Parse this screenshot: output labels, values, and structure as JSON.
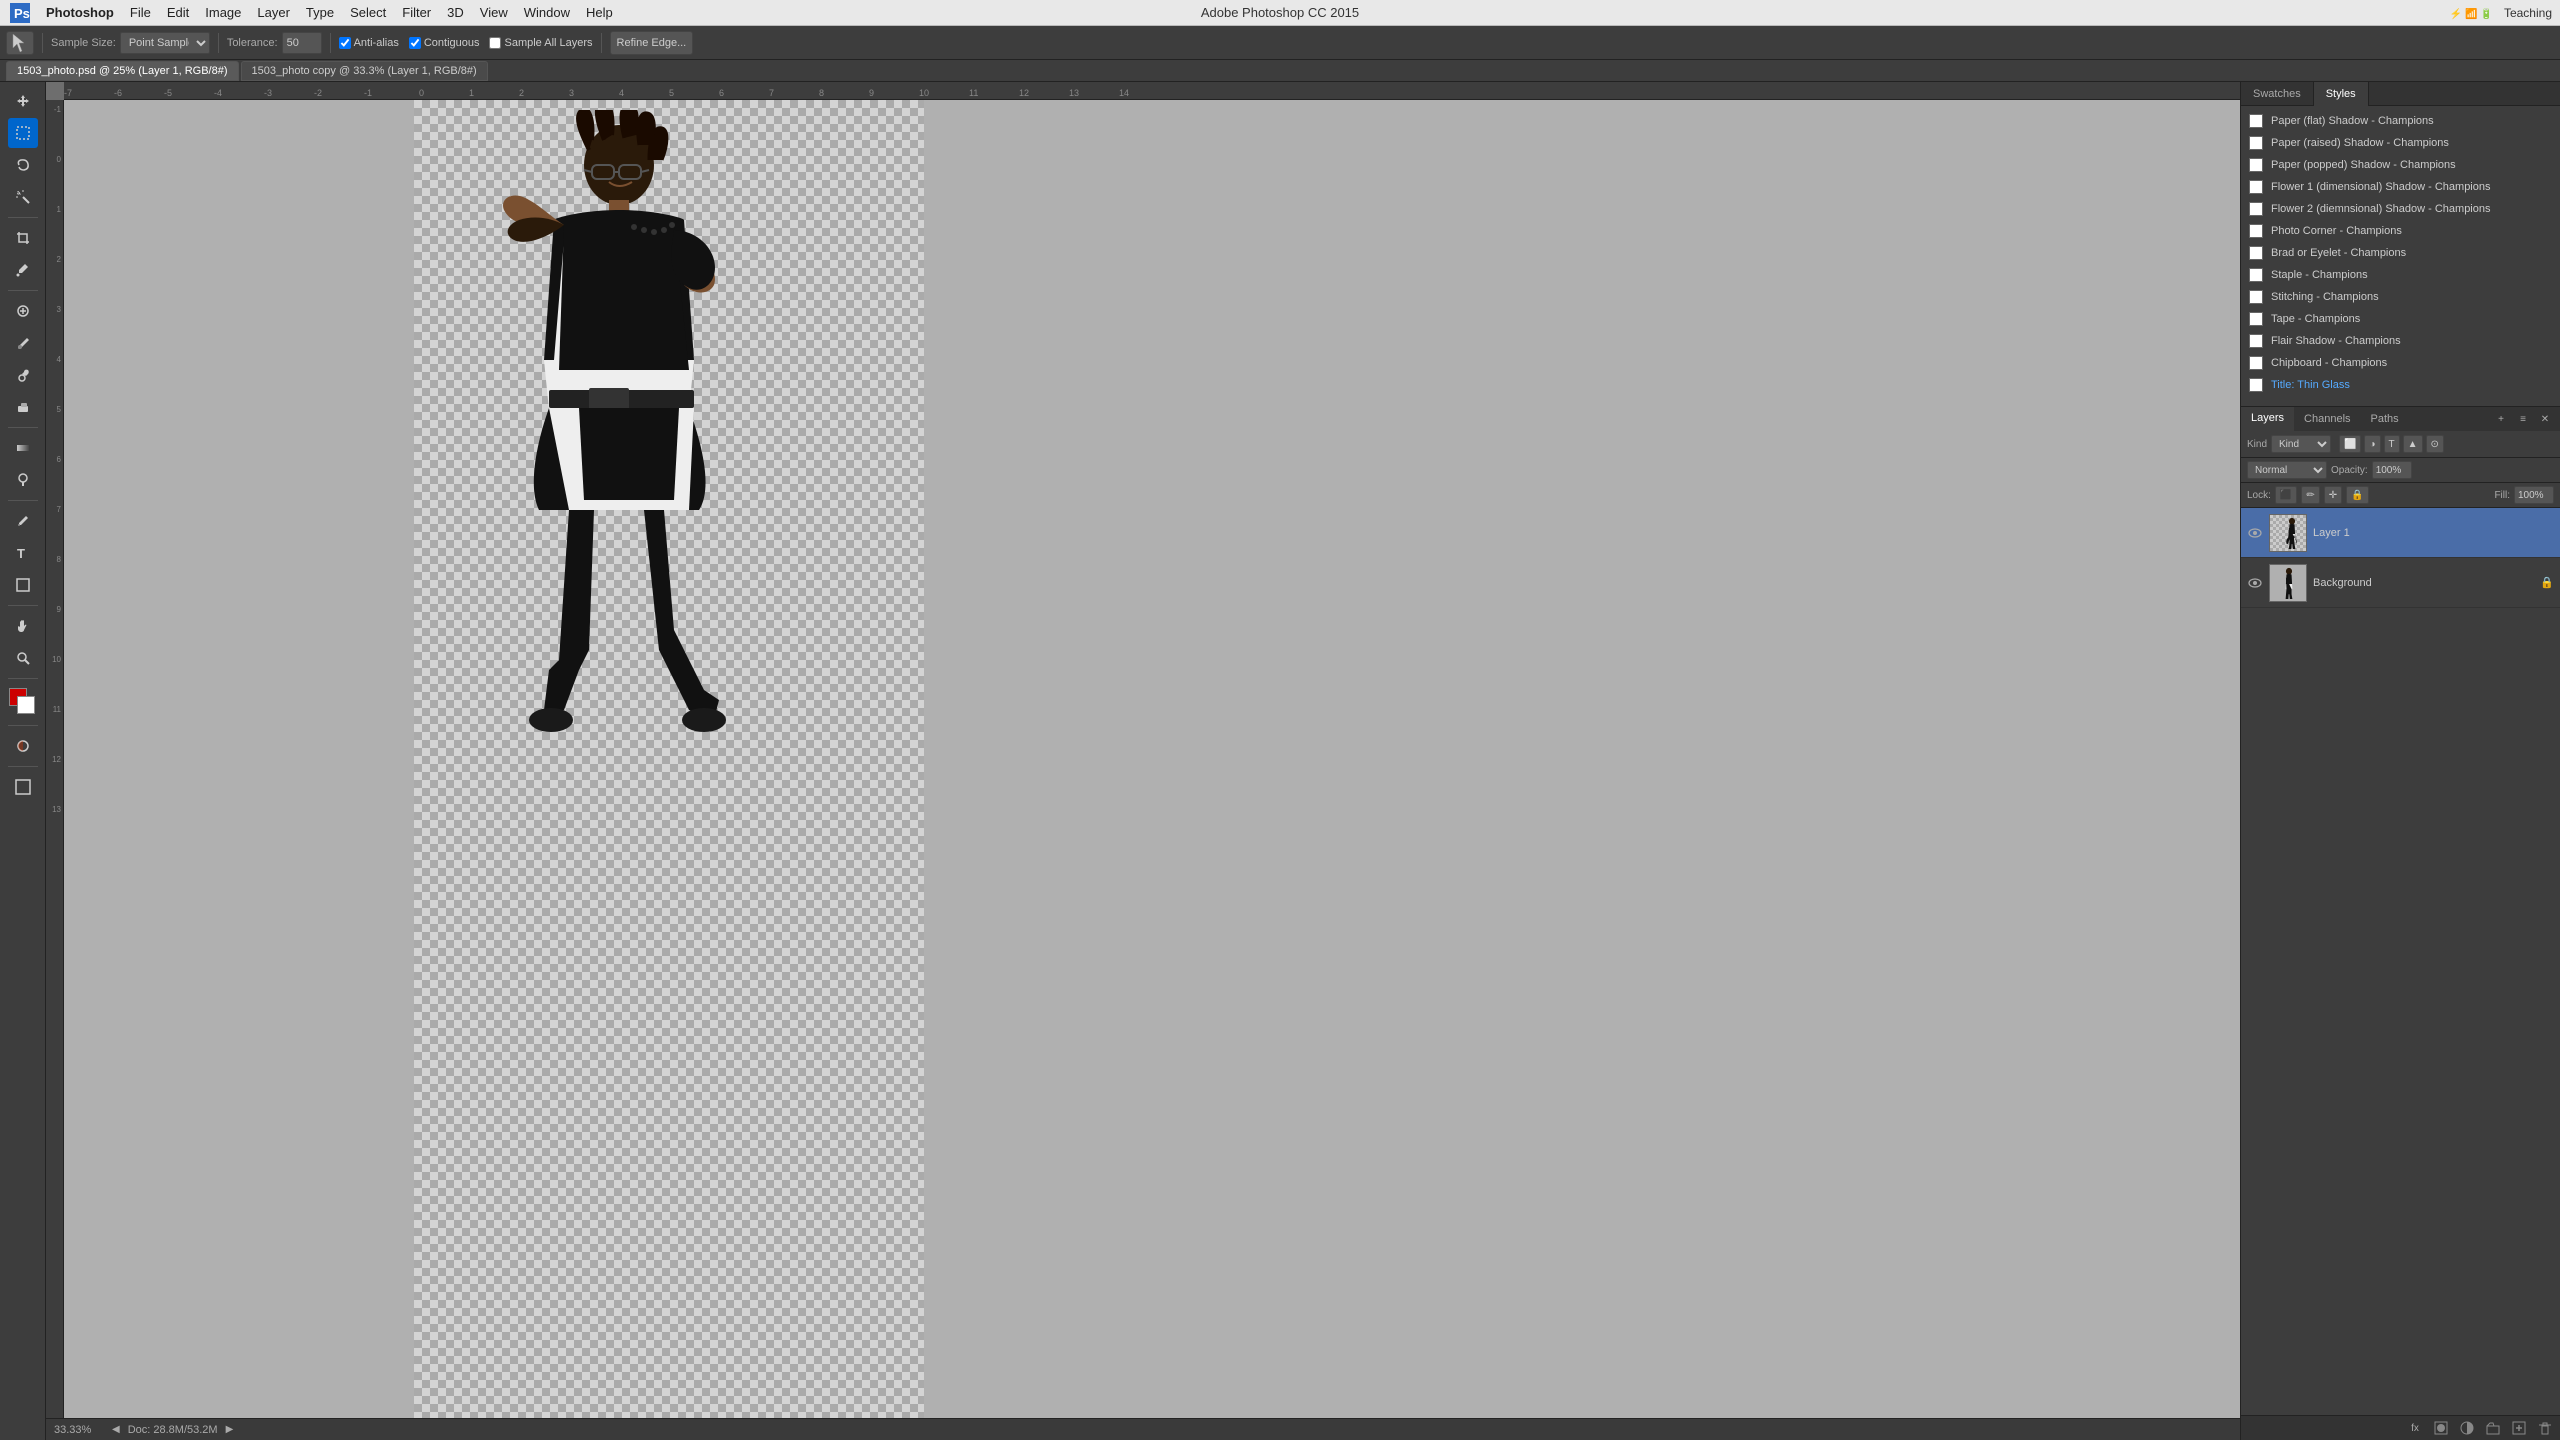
{
  "app": {
    "name": "Adobe Photoshop CC 2015",
    "title": "Adobe Photoshop CC 2015",
    "workspace": "Teaching"
  },
  "menubar": {
    "items": [
      "Photoshop",
      "File",
      "Edit",
      "Image",
      "Layer",
      "Type",
      "Select",
      "Filter",
      "3D",
      "View",
      "Window",
      "Help"
    ],
    "workspace_label": "Teaching"
  },
  "toolbar": {
    "sample_size_label": "Sample Size:",
    "sample_size_value": "Point Sample",
    "tolerance_label": "Tolerance:",
    "tolerance_value": "50",
    "anti_alias_label": "Anti-alias",
    "contiguous_label": "Contiguous",
    "sample_all_label": "Sample All Layers",
    "refine_edge_label": "Refine Edge..."
  },
  "tabs": {
    "tab1_label": "1503_photo.psd @ 25% (Layer 1, RGB/8#)",
    "tab2_label": "1503_photo copy @ 33.3% (Layer 1, RGB/8#)"
  },
  "styles_panel": {
    "tab1": "Swatches",
    "tab2": "Styles",
    "items": [
      {
        "name": "Paper (flat) Shadow - Champions",
        "checked": false
      },
      {
        "name": "Paper (raised) Shadow - Champions",
        "checked": false
      },
      {
        "name": "Paper (popped) Shadow - Champions",
        "checked": false
      },
      {
        "name": "Flower 1 (dimensional) Shadow - Champions",
        "checked": false
      },
      {
        "name": "Flower 2 (diemnsional) Shadow - Champions",
        "checked": false
      },
      {
        "name": "Photo Corner - Champions",
        "checked": false
      },
      {
        "name": "Brad or Eyelet - Champions",
        "checked": false
      },
      {
        "name": "Staple - Champions",
        "checked": false
      },
      {
        "name": "Stitching - Champions",
        "checked": false
      },
      {
        "name": "Tape - Champions",
        "checked": false
      },
      {
        "name": "Flair Shadow - Champions",
        "checked": false
      },
      {
        "name": "Chipboard - Champions",
        "checked": false
      },
      {
        "name": "Title: Thin Glass",
        "checked": false,
        "highlighted": true
      }
    ]
  },
  "layers_panel": {
    "tabs": [
      "Layers",
      "Channels",
      "Paths"
    ],
    "blend_mode": "Normal",
    "opacity_label": "Opacity:",
    "opacity_value": "100%",
    "fill_label": "Fill:",
    "fill_value": "100%",
    "lock_label": "Lock:",
    "layers": [
      {
        "name": "Layer 1",
        "visible": true,
        "selected": true,
        "type": "content"
      },
      {
        "name": "Background",
        "visible": true,
        "selected": false,
        "type": "background",
        "locked": true
      }
    ],
    "footer_buttons": [
      "+",
      "fx",
      "◻",
      "◫",
      "⊕",
      "✕"
    ]
  },
  "canvas": {
    "zoom": "33.33%",
    "doc_size": "Doc: 28.8M/53.2M"
  },
  "ruler": {
    "h_labels": [
      "-7",
      "-6",
      "-5",
      "-4",
      "-3",
      "-2",
      "-1",
      "0",
      "1",
      "2",
      "3",
      "4",
      "5",
      "6",
      "7",
      "8",
      "9",
      "10",
      "11",
      "12",
      "13",
      "14"
    ],
    "v_labels": [
      "-1",
      "0",
      "1",
      "2",
      "3",
      "4",
      "5",
      "6",
      "7",
      "8",
      "9",
      "10",
      "11",
      "12"
    ]
  },
  "statusbar": {
    "zoom": "33.33%",
    "doc_info": "Doc: 28.8M/53.2M"
  }
}
